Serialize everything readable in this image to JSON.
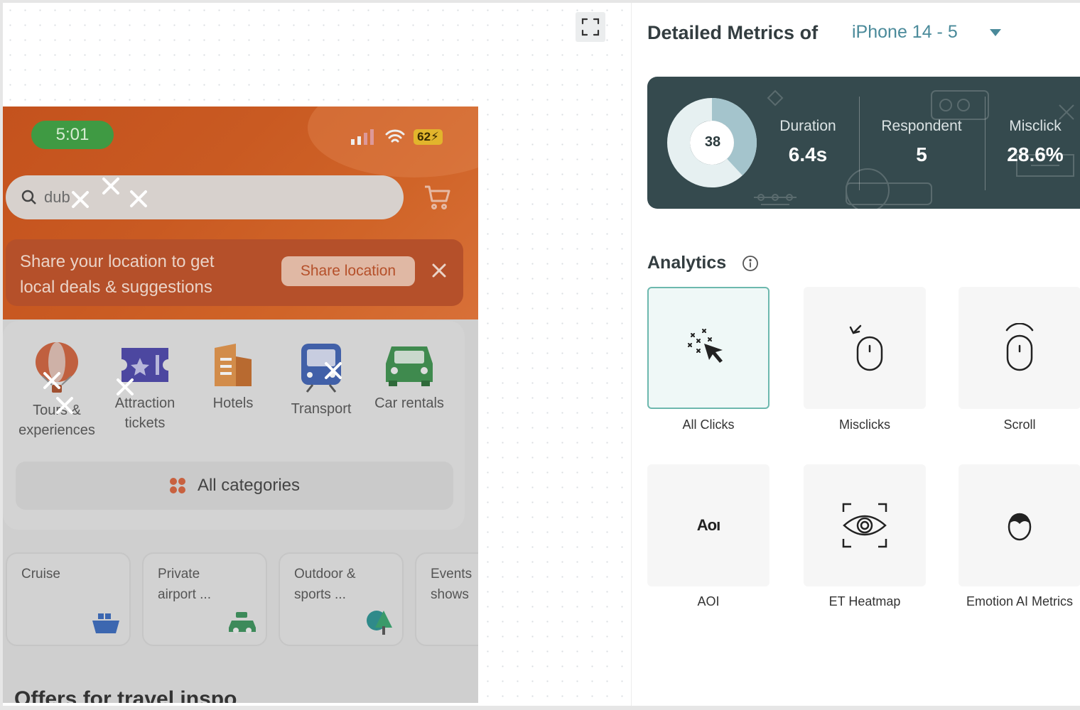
{
  "phone": {
    "time": "5:01",
    "battery": "62⚡",
    "search_text": "dub",
    "location_banner": {
      "line1": "Share your location to get",
      "line2": "local deals & suggestions",
      "button": "Share location"
    },
    "categories": [
      {
        "line1": "Tours &",
        "line2": "experiences",
        "icon": "balloon-icon"
      },
      {
        "line1": "Attraction",
        "line2": "tickets",
        "icon": "ticket-icon"
      },
      {
        "line1": "Hotels",
        "line2": "",
        "icon": "hotel-icon"
      },
      {
        "line1": "Transport",
        "line2": "",
        "icon": "train-icon"
      },
      {
        "line1": "Car rentals",
        "line2": "",
        "icon": "car-icon"
      }
    ],
    "all_categories": "All categories",
    "sub_cards": [
      {
        "line1": "Cruise",
        "line2": "",
        "icon": "ship-icon"
      },
      {
        "line1": "Private",
        "line2": "airport ...",
        "icon": "car-luggage-icon"
      },
      {
        "line1": "Outdoor &",
        "line2": "sports ...",
        "icon": "tree-icon"
      },
      {
        "line1": "Events",
        "line2": "shows",
        "icon": "ticket-icon"
      }
    ],
    "offers_heading": "Offers for travel inspo"
  },
  "panel": {
    "title": "Detailed Metrics of",
    "device": "iPhone 14 - 5",
    "donut": {
      "value": "38",
      "fraction": 0.38,
      "colors": {
        "filled": "#a4c4cc",
        "rest": "#e6f0f1"
      }
    },
    "metrics": [
      {
        "label": "Duration",
        "value": "6.4s"
      },
      {
        "label": "Respondent",
        "value": "5"
      },
      {
        "label": "Misclick",
        "value": "28.6%"
      }
    ],
    "analytics_title": "Analytics",
    "tiles": [
      {
        "label": "All Clicks",
        "icon": "all-clicks-icon",
        "active": true
      },
      {
        "label": "Misclicks",
        "icon": "misclick-mouse-icon",
        "active": false
      },
      {
        "label": "Scroll",
        "icon": "scroll-mouse-icon",
        "active": false
      },
      {
        "label": "AOI",
        "icon": "aoi-icon",
        "glyph": "Aoı",
        "active": false
      },
      {
        "label": "ET Heatmap",
        "icon": "eye-tracking-icon",
        "active": false
      },
      {
        "label": "Emotion AI Metrics",
        "icon": "face-icon",
        "active": false
      }
    ],
    "colors": {
      "dark": "#354a4e",
      "accent": "#4a8a9a",
      "active_border": "#6db8ae"
    }
  }
}
